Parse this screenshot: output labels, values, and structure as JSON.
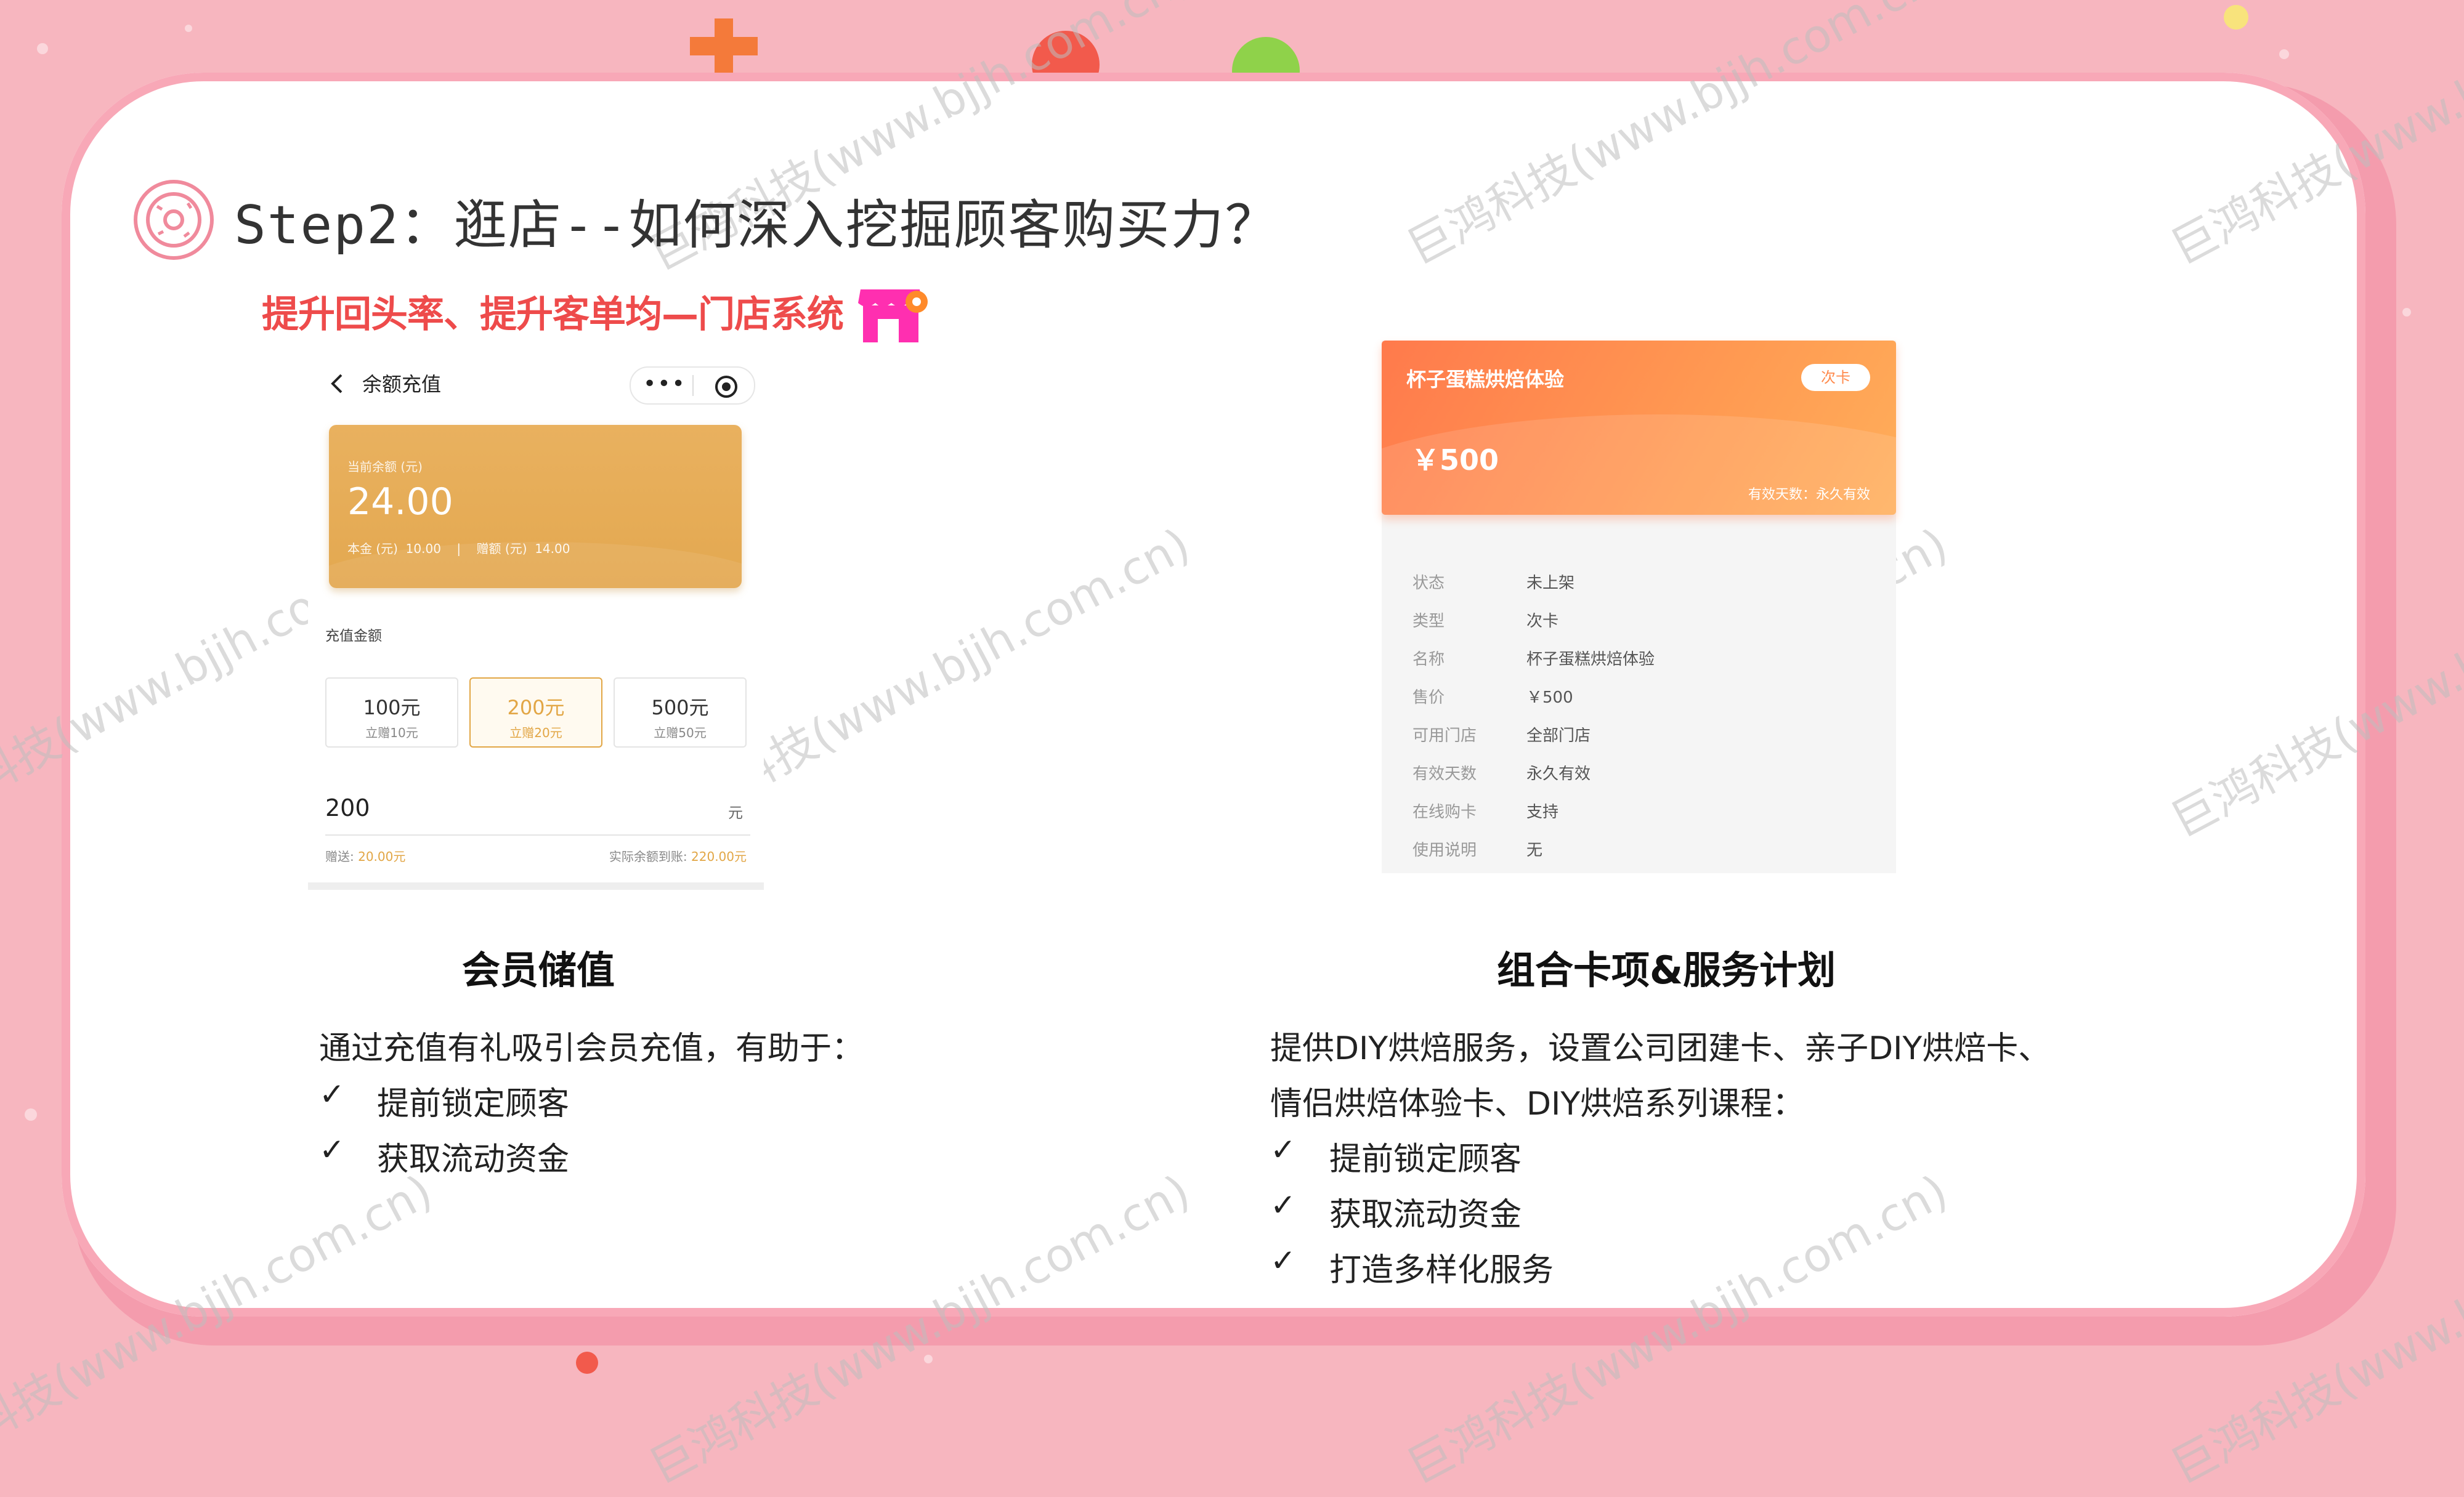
{
  "header": {
    "title": "Step2：逛店--如何深入挖掘顾客购买力？",
    "subtitle": "提升回头率、提升客单均—门店系统"
  },
  "watermark": {
    "cn": "巨鸿科技(www.bjjh.com.cn)"
  },
  "left_phone": {
    "nav_title": "余额充值",
    "capsule_more": "•••",
    "balance_label": "当前余额 (元)",
    "balance_amount": "24.00",
    "balance_detail": "本金 (元)  10.00    |    赠额 (元)  14.00",
    "recharge_label": "充值金额",
    "options": [
      {
        "amount": "100元",
        "gift": "立赠10元"
      },
      {
        "amount": "200元",
        "gift": "立赠20元"
      },
      {
        "amount": "500元",
        "gift": "立赠50元"
      }
    ],
    "input_value": "200",
    "input_unit": "元",
    "gift_note_label": "赠送: ",
    "gift_note_value": "20.00元",
    "actual_note_label": "实际余额到账: ",
    "actual_note_value": "220.00元"
  },
  "right_card": {
    "card_name": "杯子蛋糕烘焙体验",
    "card_badge": "次卡",
    "card_price": "￥500",
    "card_valid": "有效天数：永久有效",
    "details": [
      {
        "key": "状态",
        "value": "未上架"
      },
      {
        "key": "类型",
        "value": "次卡"
      },
      {
        "key": "名称",
        "value": "杯子蛋糕烘焙体验"
      },
      {
        "key": "售价",
        "value": "￥500"
      },
      {
        "key": "可用门店",
        "value": "全部门店"
      },
      {
        "key": "有效天数",
        "value": "永久有效"
      },
      {
        "key": "在线购卡",
        "value": "支持"
      },
      {
        "key": "使用说明",
        "value": "无"
      }
    ]
  },
  "left_section": {
    "heading": "会员储值",
    "intro": "通过充值有礼吸引会员充值，有助于：",
    "points": [
      "提前锁定顾客",
      "获取流动资金"
    ],
    "check_mark": "✓"
  },
  "right_section": {
    "heading": "组合卡项&服务计划",
    "intro_line1": "提供DIY烘焙服务，设置公司团建卡、亲子DIY烘焙卡、",
    "intro_line2": "情侣烘焙体验卡、DIY烘焙系列课程：",
    "points": [
      "提前锁定顾客",
      "获取流动资金",
      "打造多样化服务"
    ],
    "check_mark": "✓"
  },
  "colors": {
    "background": "#f7b6bf",
    "subtitle_red": "#ee4b4b",
    "gold_card": "#e3a850",
    "orange_card": "#ff8a4c"
  }
}
